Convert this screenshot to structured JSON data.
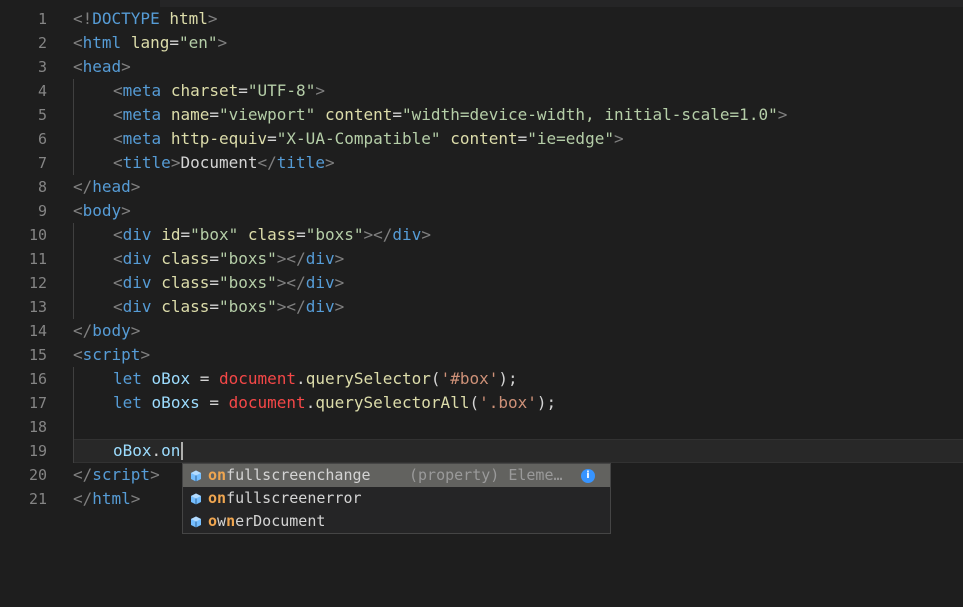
{
  "line_numbers": [
    "1",
    "2",
    "3",
    "4",
    "5",
    "6",
    "7",
    "8",
    "9",
    "10",
    "11",
    "12",
    "13",
    "14",
    "15",
    "16",
    "17",
    "18",
    "19",
    "20",
    "21"
  ],
  "code": {
    "l1": {
      "open": "<!",
      "doctype": "DOCTYPE",
      "html": "html",
      "close": ">"
    },
    "l2": {
      "open": "<",
      "tag": "html",
      "attr": "lang",
      "eq": "=",
      "val": "\"en\"",
      "close": ">"
    },
    "l3": {
      "open": "<",
      "tag": "head",
      "close": ">"
    },
    "l4": {
      "open": "<",
      "tag": "meta",
      "attr": "charset",
      "eq": "=",
      "val": "\"UTF-8\"",
      "close": ">"
    },
    "l5": {
      "open": "<",
      "tag": "meta",
      "attr1": "name",
      "eq1": "=",
      "val1": "\"viewport\"",
      "attr2": "content",
      "eq2": "=",
      "val2": "\"width=device-width, initial-scale=1.0\"",
      "close": ">"
    },
    "l6": {
      "open": "<",
      "tag": "meta",
      "attr1": "http-equiv",
      "eq1": "=",
      "val1": "\"X-UA-Compatible\"",
      "attr2": "content",
      "eq2": "=",
      "val2": "\"ie=edge\"",
      "close": ">"
    },
    "l7": {
      "open": "<",
      "tag": "title",
      "mid1": ">",
      "text": "Document",
      "mid2": "</",
      "tag2": "title",
      "close": ">"
    },
    "l8": {
      "open": "</",
      "tag": "head",
      "close": ">"
    },
    "l9": {
      "open": "<",
      "tag": "body",
      "close": ">"
    },
    "l10": {
      "open": "<",
      "tag": "div",
      "attr1": "id",
      "eq1": "=",
      "val1": "\"box\"",
      "attr2": "class",
      "eq2": "=",
      "val2": "\"boxs\"",
      "mid": "></",
      "tag2": "div",
      "close": ">"
    },
    "l11": {
      "open": "<",
      "tag": "div",
      "attr": "class",
      "eq": "=",
      "val": "\"boxs\"",
      "mid": "></",
      "tag2": "div",
      "close": ">"
    },
    "l12": {
      "open": "<",
      "tag": "div",
      "attr": "class",
      "eq": "=",
      "val": "\"boxs\"",
      "mid": "></",
      "tag2": "div",
      "close": ">"
    },
    "l13": {
      "open": "<",
      "tag": "div",
      "attr": "class",
      "eq": "=",
      "val": "\"boxs\"",
      "mid": "></",
      "tag2": "div",
      "close": ">"
    },
    "l14": {
      "open": "</",
      "tag": "body",
      "close": ">"
    },
    "l15": {
      "open": "<",
      "tag": "script",
      "close": ">"
    },
    "l16": {
      "kw": "let",
      "var": "oBox",
      "op": " = ",
      "obj": "document",
      "dot": ".",
      "fn": "querySelector",
      "p1": "(",
      "str": "'#box'",
      "p2": ");"
    },
    "l17": {
      "kw": "let",
      "var": "oBoxs",
      "op": " = ",
      "obj": "document",
      "dot": ".",
      "fn": "querySelectorAll",
      "p1": "(",
      "str": "'.box'",
      "p2": ");"
    },
    "l19": {
      "var": "oBox",
      "dot": ".",
      "typed": "on"
    },
    "l20": {
      "open": "</",
      "tag": "script",
      "close": ">"
    },
    "l21": {
      "open": "</",
      "tag": "html",
      "close": ">"
    }
  },
  "suggestions": [
    {
      "match": "on",
      "rest": "fullscreenchange",
      "detail": "(property) Eleme…",
      "icon": "property-cube-icon",
      "info_icon": "i"
    },
    {
      "match": "on",
      "rest": "fullscreenerror",
      "icon": "property-cube-icon"
    },
    {
      "match1": "o",
      "mid": "w",
      "match2": "n",
      "rest": "erDocument",
      "icon": "property-cube-icon"
    }
  ],
  "colors": {
    "background": "#1e1e1e",
    "tag": "#569cd6",
    "attribute": "#9cdcfe",
    "string": "#ce9178",
    "function": "#dcdcaa",
    "error_red": "#f44747",
    "match_highlight": "#f0a650"
  }
}
